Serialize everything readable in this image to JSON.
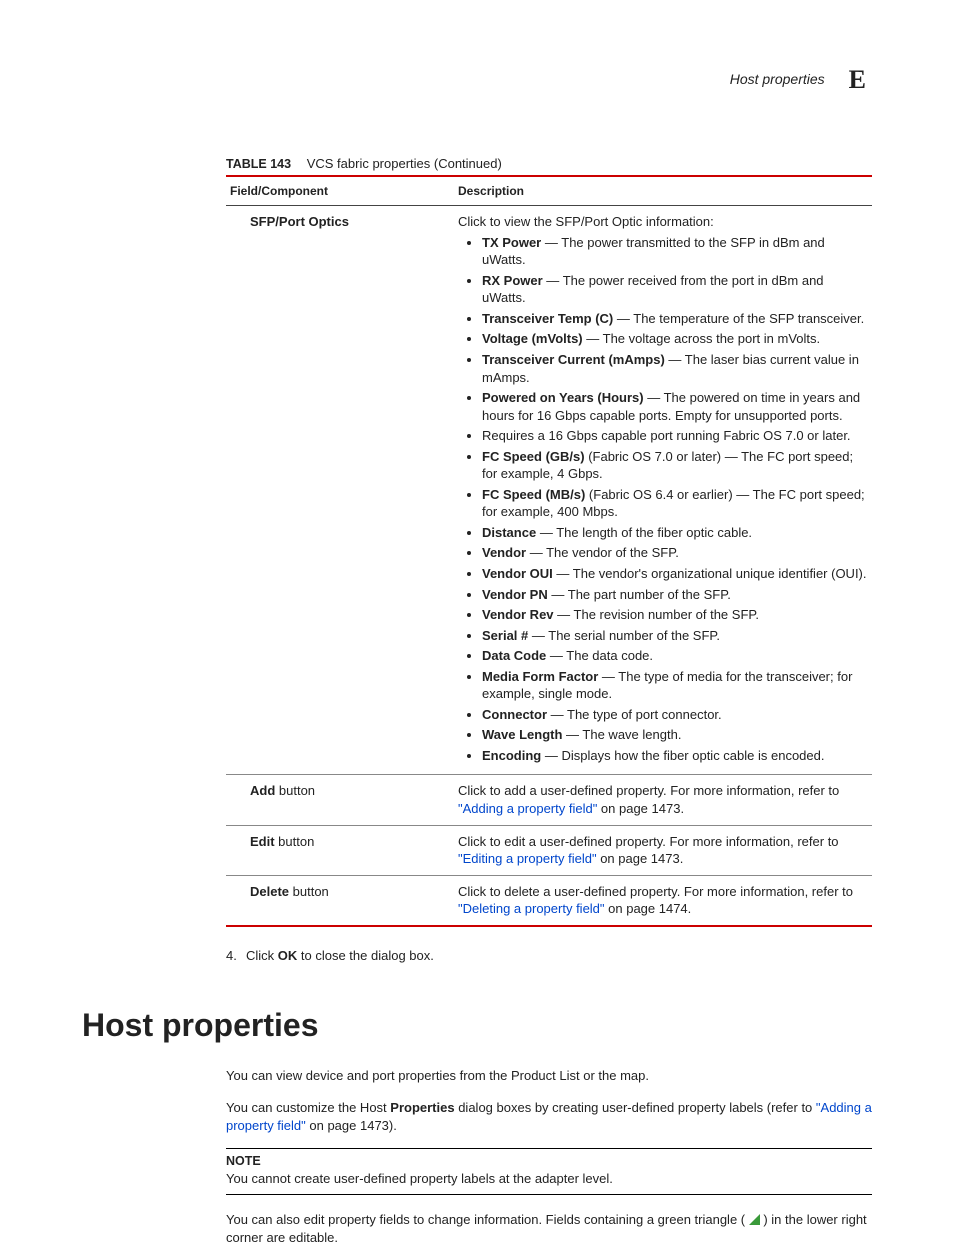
{
  "runningHeader": {
    "title": "Host properties",
    "letter": "E"
  },
  "table": {
    "captionNumber": "TABLE 143",
    "captionTitle": "VCS fabric properties (Continued)",
    "header": {
      "field": "Field/Component",
      "desc": "Description"
    },
    "rows": {
      "sfp": {
        "field": "SFP/Port Optics",
        "lead": "Click to view the SFP/Port Optic information:",
        "items": [
          {
            "term": "TX Power",
            "sep": " — ",
            "text": "The power transmitted to the SFP in dBm and uWatts."
          },
          {
            "term": "RX Power",
            "sep": " — ",
            "text": "The power received from the port in dBm and uWatts."
          },
          {
            "term": "Transceiver Temp (C)",
            "sep": " — ",
            "text": "The temperature of the SFP transceiver."
          },
          {
            "term": "Voltage (mVolts)",
            "sep": " — ",
            "text": "The voltage across the port in mVolts."
          },
          {
            "term": "Transceiver Current (mAmps)",
            "sep": " — ",
            "text": "The laser bias current value in mAmps."
          },
          {
            "term": "Powered on Years (Hours)",
            "sep": " — ",
            "text": "The powered on time in years and hours for 16 Gbps capable ports. Empty for unsupported ports."
          },
          {
            "term": "",
            "sep": "",
            "text": "Requires a 16 Gbps capable port running Fabric OS 7.0 or later."
          },
          {
            "term": "FC Speed (GB/s)",
            "sep": " ",
            "text": "(Fabric OS 7.0 or later) — The FC port speed; for example, 4 Gbps."
          },
          {
            "term": "FC Speed (MB/s)",
            "sep": " ",
            "text": "(Fabric OS 6.4 or earlier) — The FC port speed; for example, 400 Mbps."
          },
          {
            "term": "Distance",
            "sep": " — ",
            "text": "The length of the fiber optic cable."
          },
          {
            "term": "Vendor",
            "sep": " — ",
            "text": "The vendor of the SFP."
          },
          {
            "term": "Vendor OUI",
            "sep": " — ",
            "text": "The vendor's organizational unique identifier (OUI)."
          },
          {
            "term": "Vendor PN",
            "sep": " — ",
            "text": "The part number of the SFP."
          },
          {
            "term": "Vendor Rev",
            "sep": " — ",
            "text": "The revision number of the SFP."
          },
          {
            "term": "Serial #",
            "sep": " — ",
            "text": "The serial number of the SFP."
          },
          {
            "term": "Data Code",
            "sep": " — ",
            "text": "The data code."
          },
          {
            "term": "Media Form Factor",
            "sep": " — ",
            "text": "The type of media for the transceiver; for example, single mode."
          },
          {
            "term": "Connector",
            "sep": " — ",
            "text": "The type of port connector."
          },
          {
            "term": "Wave Length",
            "sep": " — ",
            "text": "The wave length."
          },
          {
            "term": "Encoding",
            "sep": " — ",
            "text": "Displays how the fiber optic cable is encoded."
          }
        ]
      },
      "add": {
        "fieldTerm": "Add",
        "fieldRest": " button",
        "pre": "Click to add a user-defined property. For more information, refer to ",
        "link": "\"Adding a property field\"",
        "post": " on page 1473."
      },
      "edit": {
        "fieldTerm": "Edit",
        "fieldRest": " button",
        "pre": "Click to edit a user-defined property. For more information, refer to ",
        "link": "\"Editing a property field\"",
        "post": " on page 1473."
      },
      "delete": {
        "fieldTerm": "Delete",
        "fieldRest": " button",
        "pre": "Click to delete a user-defined property. For more information, refer to ",
        "link": "\"Deleting a property field\"",
        "post": " on page 1474."
      }
    }
  },
  "step": {
    "num": "4.",
    "pre": "Click ",
    "bold": "OK",
    "post": " to close the dialog box."
  },
  "section": {
    "title": "Host properties",
    "para1": "You can view device and port properties from the Product List or the map.",
    "para2": {
      "a": "You can customize the Host ",
      "b": "Properties",
      "c": " dialog boxes by creating user-defined property labels (refer to ",
      "link": "\"Adding a property field\"",
      "d": " on page 1473)."
    },
    "noteLabel": "NOTE",
    "noteText": "You cannot create user-defined property labels at the adapter level.",
    "para3": {
      "a": "You can also edit property fields to change information. Fields containing a green triangle ( ",
      "b": " ) in the lower right corner are editable."
    }
  }
}
